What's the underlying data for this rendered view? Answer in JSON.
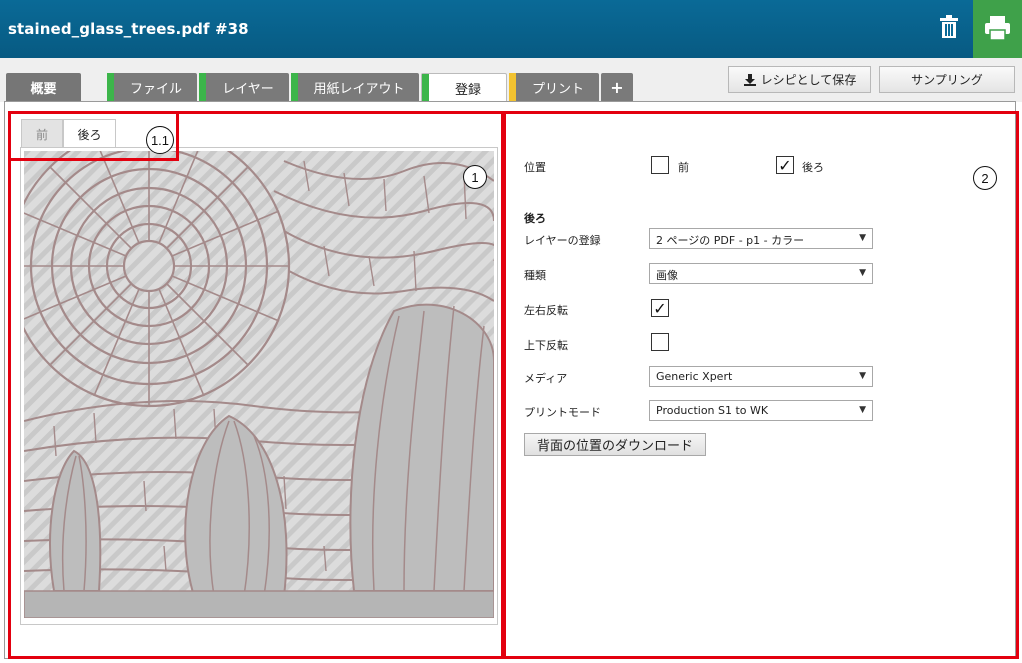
{
  "window": {
    "title": "stained_glass_trees.pdf #38"
  },
  "toolbar": {
    "delete_icon": "trash-icon",
    "print_icon": "printer-icon",
    "print_color": "#3fa14a"
  },
  "tabs": [
    {
      "label": "概要",
      "stripe": ""
    },
    {
      "label": "ファイル",
      "stripe": "#3cb54a"
    },
    {
      "label": "レイヤー",
      "stripe": "#3cb54a"
    },
    {
      "label": "用紙レイアウト",
      "stripe": "#3cb54a"
    },
    {
      "label": "登録",
      "stripe": "#3cb54a"
    },
    {
      "label": "プリント",
      "stripe": "#f2c230"
    },
    {
      "label": "+",
      "stripe": ""
    }
  ],
  "actions": {
    "save_recipe": "レシピとして保存",
    "sampling": "サンプリング"
  },
  "preview": {
    "tabs": [
      "前",
      "後ろ"
    ]
  },
  "form": {
    "position_label": "位置",
    "front_label": "前",
    "front_checked": false,
    "back_label": "後ろ",
    "back_checked": true,
    "section_title": "後ろ",
    "layer_registration_label": "レイヤーの登録",
    "layer_registration_value": "2 ページの PDF - p1 - カラー",
    "type_label": "種類",
    "type_value": "画像",
    "mirror_h_label": "左右反転",
    "mirror_h_checked": true,
    "mirror_v_label": "上下反転",
    "mirror_v_checked": false,
    "media_label": "メディア",
    "media_value": "Generic Xpert",
    "print_mode_label": "プリントモード",
    "print_mode_value": "Production S1 to WK",
    "download_button": "背面の位置のダウンロード"
  },
  "annotations": {
    "callout_1": "1",
    "callout_1_1": "1.1",
    "callout_2": "2",
    "color": "#e3000f"
  }
}
